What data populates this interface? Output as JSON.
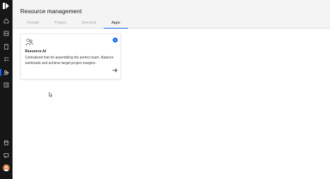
{
  "header": {
    "title": "Resource management",
    "tabs": [
      {
        "label": "People",
        "active": false
      },
      {
        "label": "Project",
        "active": false
      },
      {
        "label": "Demand",
        "active": false
      },
      {
        "label": "Apps",
        "active": true
      }
    ]
  },
  "sidebar": {
    "items": [
      {
        "icon": "home-icon"
      },
      {
        "icon": "dashboard-icon"
      },
      {
        "icon": "clipboard-icon"
      },
      {
        "icon": "checklist-icon"
      },
      {
        "icon": "resource-icon",
        "active": true
      },
      {
        "icon": "report-icon"
      },
      {
        "icon": "store-icon"
      },
      {
        "icon": "feedback-icon"
      }
    ]
  },
  "card": {
    "icon": "people-group-icon",
    "badge_icon": "ai-badge-icon",
    "title": "Resource AI",
    "description": "Centralized hub for assembling the perfect team. Balance workloads and achieve target project margins.",
    "action_icon": "arrow-right-icon"
  },
  "colors": {
    "accent": "#0f62fe",
    "rail": "#161616",
    "header_bg": "#f4f4f4"
  }
}
